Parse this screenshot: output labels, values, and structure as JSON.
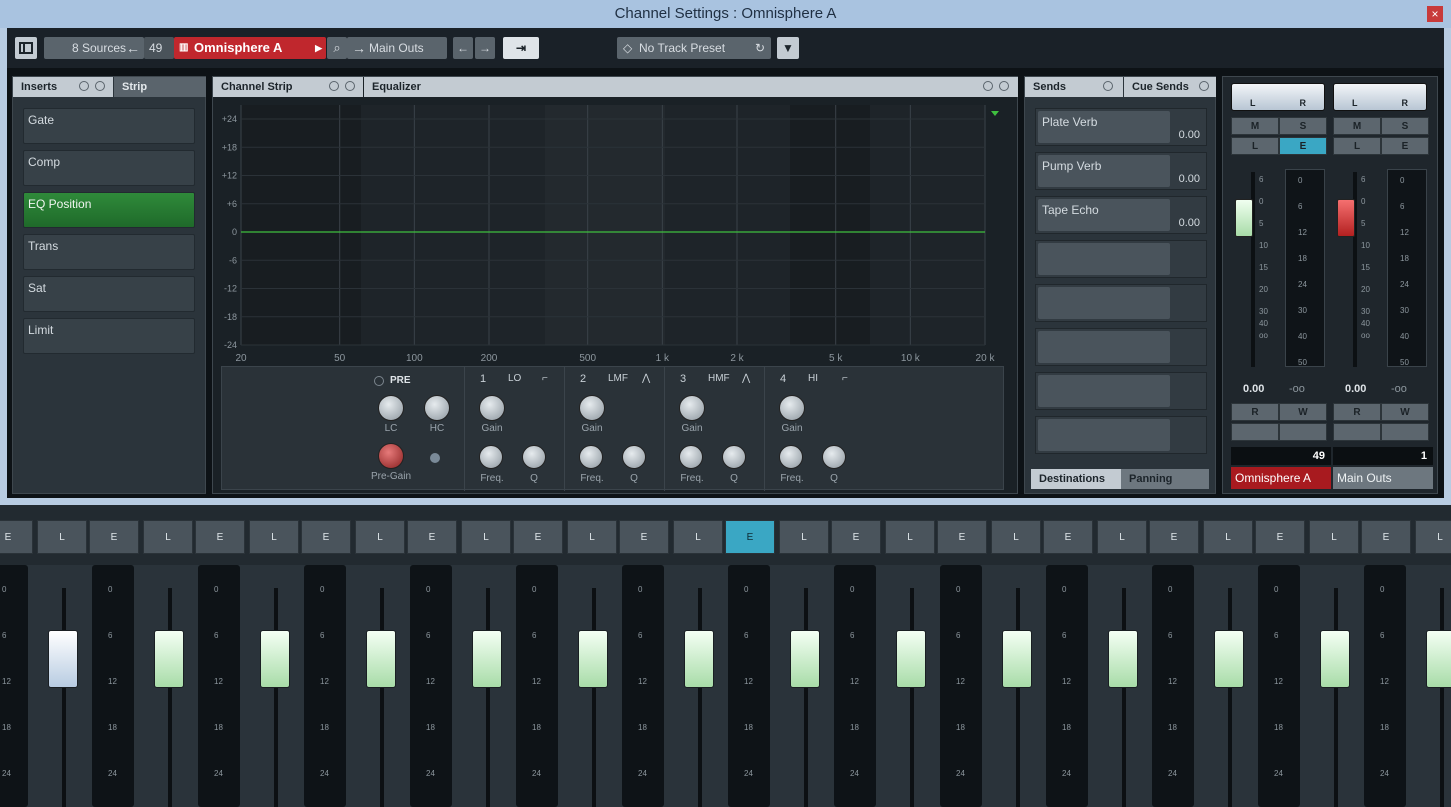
{
  "window": {
    "title": "Channel Settings : Omnisphere A",
    "close_label": "×"
  },
  "toolbar": {
    "sources": "8 Sources",
    "channel_number": "49",
    "channel_name": "Omnisphere A",
    "output": "Main Outs",
    "preset": "No Track Preset"
  },
  "inserts": {
    "tab_inserts": "Inserts",
    "tab_strip": "Strip",
    "slots": [
      "Gate",
      "Comp",
      "EQ Position",
      "Trans",
      "Sat",
      "Limit"
    ],
    "active_slot": "EQ Position"
  },
  "channel_strip": {
    "tab": "Channel Strip",
    "equalizer_label": "Equalizer"
  },
  "eq": {
    "db_ticks": [
      "+24",
      "+18",
      "+12",
      "+6",
      "0",
      "-6",
      "-12",
      "-18",
      "-24"
    ],
    "freq_ticks": [
      "20",
      "50",
      "100",
      "200",
      "500",
      "1 k",
      "2 k",
      "5 k",
      "10 k",
      "20 k"
    ],
    "pre_label": "PRE",
    "lc_label": "LC",
    "hc_label": "HC",
    "pregain_label": "Pre-Gain",
    "bands": [
      {
        "num": "1",
        "name": "LO",
        "gain": "Gain",
        "freq": "Freq.",
        "q": "Q"
      },
      {
        "num": "2",
        "name": "LMF",
        "gain": "Gain",
        "freq": "Freq.",
        "q": "Q"
      },
      {
        "num": "3",
        "name": "HMF",
        "gain": "Gain",
        "freq": "Freq.",
        "q": "Q"
      },
      {
        "num": "4",
        "name": "HI",
        "gain": "Gain",
        "freq": "Freq.",
        "q": "Q"
      }
    ]
  },
  "sends": {
    "tab_sends": "Sends",
    "tab_cue": "Cue Sends",
    "items": [
      {
        "name": "Plate Verb",
        "value": "0.00"
      },
      {
        "name": "Pump Verb",
        "value": "0.00"
      },
      {
        "name": "Tape Echo",
        "value": "0.00"
      },
      {
        "name": "",
        "value": ""
      },
      {
        "name": "",
        "value": ""
      },
      {
        "name": "",
        "value": ""
      },
      {
        "name": "",
        "value": ""
      },
      {
        "name": "",
        "value": ""
      }
    ],
    "tab_destinations": "Destinations",
    "tab_panning": "Panning"
  },
  "strips": [
    {
      "L": "L",
      "R": "R",
      "M": "M",
      "S": "S",
      "Lb": "L",
      "E": "E",
      "volume": "0.00",
      "peak": "-oo",
      "read": "R",
      "write": "W",
      "number": "49",
      "name": "Omnisphere A"
    },
    {
      "L": "L",
      "R": "R",
      "M": "M",
      "S": "S",
      "Lb": "L",
      "E": "E",
      "volume": "0.00",
      "peak": "-oo",
      "read": "R",
      "write": "W",
      "number": "1",
      "name": "Main Outs"
    }
  ],
  "fader_scale": [
    "6",
    "0",
    "5",
    "10",
    "15",
    "20",
    "30",
    "40",
    "oo"
  ],
  "meter_scale": [
    "0",
    "6",
    "12",
    "18",
    "24",
    "30",
    "40",
    "50"
  ],
  "mixer": {
    "buttons_L": "L",
    "buttons_E": "E",
    "scale": [
      "0",
      "6",
      "12",
      "18",
      "24"
    ]
  },
  "colors": {
    "accent_red": "#c0272d",
    "eq_active": "#2e8a3a",
    "edit_active": "#3aa7c4",
    "titlebar": "#a9c3e0"
  }
}
